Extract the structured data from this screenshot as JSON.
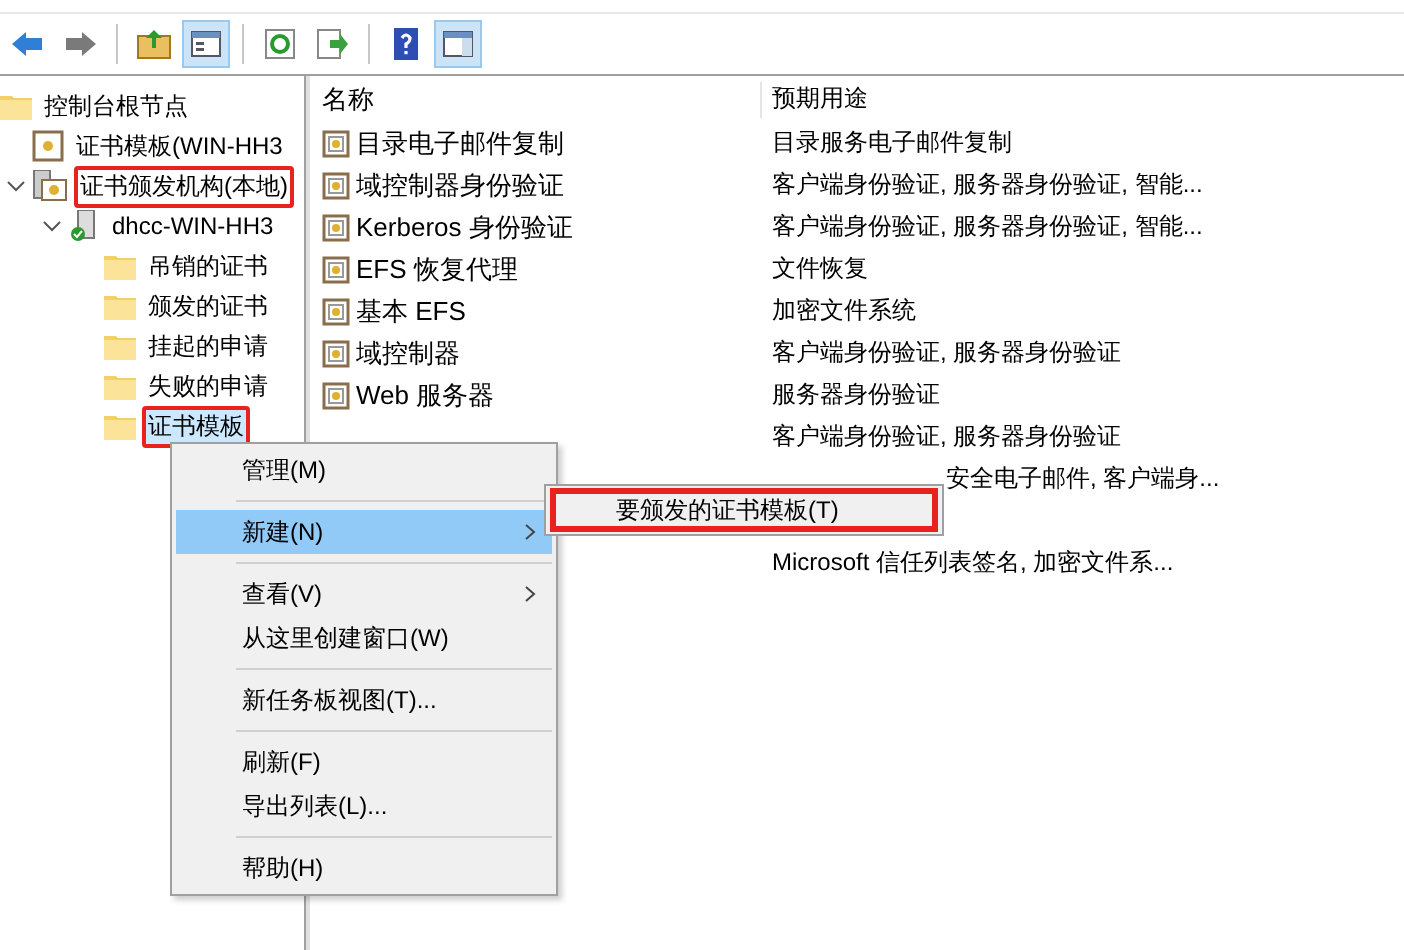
{
  "toolbar": {
    "buttons": [
      {
        "kind": "back"
      },
      {
        "kind": "forward"
      },
      {
        "kind": "sep"
      },
      {
        "kind": "up"
      },
      {
        "kind": "tree",
        "selected": true
      },
      {
        "kind": "sep"
      },
      {
        "kind": "refresh"
      },
      {
        "kind": "export"
      },
      {
        "kind": "sep"
      },
      {
        "kind": "help"
      },
      {
        "kind": "panel",
        "selected": true
      }
    ]
  },
  "tree": [
    {
      "label": "控制台根节点",
      "kind": "folder",
      "children": [
        {
          "label": "证书模板(WIN-HH3",
          "kind": "cert"
        },
        {
          "label": "证书颁发机构(本地)",
          "kind": "ca",
          "expanded": true,
          "highlighted": true,
          "children": [
            {
              "label": "dhcc-WIN-HH3",
              "kind": "server",
              "expanded": true,
              "children": [
                {
                  "label": "吊销的证书",
                  "kind": "folder"
                },
                {
                  "label": "颁发的证书",
                  "kind": "folder"
                },
                {
                  "label": "挂起的申请",
                  "kind": "folder"
                },
                {
                  "label": "失败的申请",
                  "kind": "folder"
                },
                {
                  "label": "证书模板",
                  "kind": "folder",
                  "selected": true,
                  "highlighted": true
                }
              ]
            }
          ]
        }
      ]
    }
  ],
  "table": {
    "columns": [
      "名称",
      "预期用途"
    ],
    "rows": [
      {
        "kind": "full",
        "name": "目录电子邮件复制",
        "purpose": "目录服务电子邮件复制"
      },
      {
        "kind": "full",
        "name": "域控制器身份验证",
        "purpose": "客户端身份验证, 服务器身份验证, 智能..."
      },
      {
        "kind": "full",
        "name": "Kerberos 身份验证",
        "purpose": "客户端身份验证, 服务器身份验证, 智能..."
      },
      {
        "kind": "full",
        "name": "EFS 恢复代理",
        "purpose": "文件恢复"
      },
      {
        "kind": "full",
        "name": "基本 EFS",
        "purpose": "加密文件系统"
      },
      {
        "kind": "full",
        "name": "域控制器",
        "purpose": "客户端身份验证, 服务器身份验证"
      },
      {
        "kind": "full",
        "name": "Web 服务器",
        "purpose": "服务器身份验证"
      },
      {
        "kind": "purpose",
        "purpose": "客户端身份验证, 服务器身份验证"
      },
      {
        "kind": "partial",
        "purpose": "安全电子邮件, 客户端身..."
      },
      {
        "kind": "hidden"
      },
      {
        "kind": "purpose",
        "purpose": "Microsoft 信任列表签名, 加密文件系..."
      }
    ]
  },
  "context_menu": {
    "items": [
      {
        "kind": "item",
        "label": "管理(M)",
        "selected": false
      },
      {
        "kind": "sep"
      },
      {
        "kind": "item",
        "label": "新建(N)",
        "submenu": true,
        "selected": true
      },
      {
        "kind": "sep"
      },
      {
        "kind": "item",
        "label": "查看(V)",
        "submenu": true,
        "selected": false
      },
      {
        "kind": "item",
        "label": "从这里创建窗口(W)",
        "selected": false
      },
      {
        "kind": "sep"
      },
      {
        "kind": "item",
        "label": "新任务板视图(T)...",
        "selected": false
      },
      {
        "kind": "sep"
      },
      {
        "kind": "item",
        "label": "刷新(F)",
        "selected": false
      },
      {
        "kind": "item",
        "label": "导出列表(L)...",
        "selected": false
      },
      {
        "kind": "sep"
      },
      {
        "kind": "item",
        "label": "帮助(H)",
        "selected": false
      }
    ]
  },
  "submenu": {
    "items": [
      {
        "label": "要颁发的证书模板(T)",
        "highlighted": true
      }
    ]
  }
}
